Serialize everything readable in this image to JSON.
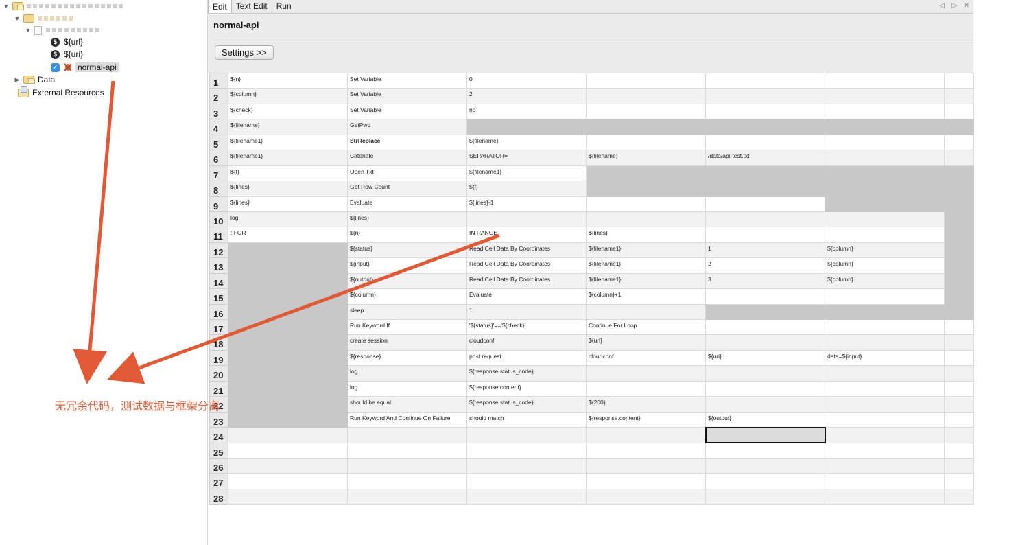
{
  "tree": {
    "nodes": [
      {
        "type": "project-root",
        "label": "",
        "blurred": true
      },
      {
        "type": "suite",
        "label": "",
        "blurred": true
      },
      {
        "type": "resource",
        "label": "",
        "blurred": true
      },
      {
        "type": "variable",
        "label": "${url}"
      },
      {
        "type": "variable",
        "label": "${uri}"
      },
      {
        "type": "testcase",
        "label": "normal-api",
        "checked": true,
        "selected": true
      },
      {
        "type": "folder",
        "label": "Data"
      },
      {
        "type": "external",
        "label": "External Resources"
      }
    ]
  },
  "tabs": [
    {
      "label": "Edit",
      "active": true
    },
    {
      "label": "Text Edit",
      "active": false
    },
    {
      "label": "Run",
      "active": false
    }
  ],
  "tab_nav": {
    "prev": "◁",
    "next": "▷",
    "close": "✕"
  },
  "test_name": "normal-api",
  "settings_button": "Settings >>",
  "grid": {
    "rows": [
      {
        "n": "1",
        "cells": [
          [
            "${n}",
            "v"
          ],
          [
            "Set Variable",
            "k"
          ],
          [
            "0",
            "b"
          ],
          [
            "",
            ""
          ],
          [
            "",
            ""
          ],
          [
            "",
            ""
          ],
          [
            "",
            ""
          ]
        ]
      },
      {
        "n": "2",
        "cells": [
          [
            "${column}",
            "v"
          ],
          [
            "Set Variable",
            "k"
          ],
          [
            "2",
            "b"
          ],
          [
            "",
            ""
          ],
          [
            "",
            ""
          ],
          [
            "",
            ""
          ],
          [
            "",
            ""
          ]
        ]
      },
      {
        "n": "3",
        "cells": [
          [
            "${check}",
            "v"
          ],
          [
            "Set Variable",
            "k"
          ],
          [
            "no",
            "b"
          ],
          [
            "",
            ""
          ],
          [
            "",
            ""
          ],
          [
            "",
            ""
          ],
          [
            "",
            ""
          ]
        ]
      },
      {
        "n": "4",
        "cells": [
          [
            "${filename}",
            "v"
          ],
          [
            "GetPwd",
            "k"
          ],
          [
            "",
            "g"
          ],
          [
            "",
            "g"
          ],
          [
            "",
            "g"
          ],
          [
            "",
            "g"
          ],
          [
            "",
            "g"
          ]
        ]
      },
      {
        "n": "5",
        "cells": [
          [
            "${filename1}",
            "v"
          ],
          [
            "StrReplace",
            "B"
          ],
          [
            "${filename}",
            "v"
          ],
          [
            "",
            ""
          ],
          [
            "",
            ""
          ],
          [
            "",
            ""
          ],
          [
            "",
            ""
          ]
        ]
      },
      {
        "n": "6",
        "cells": [
          [
            "${filename1}",
            "v"
          ],
          [
            "Catenate",
            "k"
          ],
          [
            "SEPARATOR=",
            "b"
          ],
          [
            "${filename}",
            "v"
          ],
          [
            "/data/api-test.txt",
            "b"
          ],
          [
            "",
            ""
          ],
          [
            "",
            ""
          ]
        ]
      },
      {
        "n": "7",
        "cells": [
          [
            "${f}",
            "v"
          ],
          [
            "Open Txt",
            "k"
          ],
          [
            "${filename1}",
            "v"
          ],
          [
            "",
            "g"
          ],
          [
            "",
            "g"
          ],
          [
            "",
            "g"
          ],
          [
            "",
            "g"
          ]
        ]
      },
      {
        "n": "8",
        "cells": [
          [
            "${lines}",
            "v"
          ],
          [
            "Get Row Count",
            "k"
          ],
          [
            "${f}",
            "v"
          ],
          [
            "",
            "g"
          ],
          [
            "",
            "g"
          ],
          [
            "",
            "g"
          ],
          [
            "",
            "g"
          ]
        ]
      },
      {
        "n": "9",
        "cells": [
          [
            "${lines}",
            "v"
          ],
          [
            "Evaluate",
            "k"
          ],
          [
            "${lines}-1",
            "b"
          ],
          [
            "",
            ""
          ],
          [
            "",
            ""
          ],
          [
            "",
            "g"
          ],
          [
            "",
            "g"
          ]
        ]
      },
      {
        "n": "10",
        "cells": [
          [
            "log",
            "k"
          ],
          [
            "${lines}",
            "v"
          ],
          [
            "",
            ""
          ],
          [
            "",
            ""
          ],
          [
            "",
            ""
          ],
          [
            "",
            ""
          ],
          [
            "",
            "g"
          ]
        ]
      },
      {
        "n": "11",
        "cells": [
          [
            ": FOR",
            "b"
          ],
          [
            "${n}",
            "v"
          ],
          [
            "IN RANGE",
            "b"
          ],
          [
            "${lines}",
            "v"
          ],
          [
            "",
            ""
          ],
          [
            "",
            ""
          ],
          [
            "",
            "g"
          ]
        ]
      },
      {
        "n": "12",
        "cells": [
          [
            "",
            "g"
          ],
          [
            "${status}",
            "v"
          ],
          [
            "Read Cell Data By Coordinates",
            "k"
          ],
          [
            "${filename1}",
            "v"
          ],
          [
            "1",
            "b"
          ],
          [
            "${column}",
            "v"
          ],
          [
            "",
            "g"
          ]
        ]
      },
      {
        "n": "13",
        "cells": [
          [
            "",
            "g"
          ],
          [
            "${input}",
            "v"
          ],
          [
            "Read Cell Data By Coordinates",
            "k"
          ],
          [
            "${filename1}",
            "v"
          ],
          [
            "2",
            "b"
          ],
          [
            "${column}",
            "v"
          ],
          [
            "",
            "g"
          ]
        ]
      },
      {
        "n": "14",
        "cells": [
          [
            "",
            "g"
          ],
          [
            "${output}",
            "v"
          ],
          [
            "Read Cell Data By Coordinates",
            "k"
          ],
          [
            "${filename1}",
            "v"
          ],
          [
            "3",
            "b"
          ],
          [
            "${column}",
            "v"
          ],
          [
            "",
            "g"
          ]
        ]
      },
      {
        "n": "15",
        "cells": [
          [
            "",
            "g"
          ],
          [
            "${column}",
            "v"
          ],
          [
            "Evaluate",
            "k"
          ],
          [
            "${column}+1",
            "b"
          ],
          [
            "",
            ""
          ],
          [
            "",
            ""
          ],
          [
            "",
            "g"
          ]
        ]
      },
      {
        "n": "16",
        "cells": [
          [
            "",
            "g"
          ],
          [
            "sleep",
            "k"
          ],
          [
            "1",
            "b"
          ],
          [
            "",
            ""
          ],
          [
            "",
            "g"
          ],
          [
            "",
            "g"
          ],
          [
            "",
            "g"
          ]
        ]
      },
      {
        "n": "17",
        "cells": [
          [
            "",
            "g"
          ],
          [
            "Run Keyword If",
            "k"
          ],
          [
            "'${status}'=='${check}'",
            "b"
          ],
          [
            "Continue For Loop",
            "k"
          ],
          [
            "",
            ""
          ],
          [
            "",
            ""
          ],
          [
            "",
            ""
          ]
        ]
      },
      {
        "n": "18",
        "cells": [
          [
            "",
            "g"
          ],
          [
            "create session",
            "k"
          ],
          [
            "cloudconf",
            "b"
          ],
          [
            "${url}",
            "v"
          ],
          [
            "",
            ""
          ],
          [
            "",
            ""
          ],
          [
            "",
            ""
          ]
        ]
      },
      {
        "n": "19",
        "cells": [
          [
            "",
            "g"
          ],
          [
            "${response}",
            "v"
          ],
          [
            "post request",
            "k"
          ],
          [
            "cloudconf",
            "b"
          ],
          [
            "${uri}",
            "v"
          ],
          [
            "data=${input}",
            "b"
          ],
          [
            "",
            ""
          ]
        ]
      },
      {
        "n": "20",
        "cells": [
          [
            "",
            "g"
          ],
          [
            "log",
            "k"
          ],
          [
            "${response.status_code}",
            "v"
          ],
          [
            "",
            ""
          ],
          [
            "",
            ""
          ],
          [
            "",
            ""
          ],
          [
            "",
            ""
          ]
        ]
      },
      {
        "n": "21",
        "cells": [
          [
            "",
            "g"
          ],
          [
            "log",
            "k"
          ],
          [
            "${response.content}",
            "v"
          ],
          [
            "",
            ""
          ],
          [
            "",
            ""
          ],
          [
            "",
            ""
          ],
          [
            "",
            ""
          ]
        ]
      },
      {
        "n": "22",
        "cells": [
          [
            "",
            "g"
          ],
          [
            "should be equal",
            "k"
          ],
          [
            "${response.status_code}",
            "v"
          ],
          [
            "${200}",
            "p"
          ],
          [
            "",
            ""
          ],
          [
            "",
            ""
          ],
          [
            "",
            ""
          ]
        ]
      },
      {
        "n": "23",
        "cells": [
          [
            "",
            "g"
          ],
          [
            "Run Keyword And Continue On Failure",
            "k"
          ],
          [
            "should match",
            "k"
          ],
          [
            "${response.content}",
            "v"
          ],
          [
            "${output}",
            "v"
          ],
          [
            "",
            ""
          ],
          [
            "",
            ""
          ]
        ]
      },
      {
        "n": "24",
        "cells": [
          [
            "",
            ""
          ],
          [
            "",
            ""
          ],
          [
            "",
            ""
          ],
          [
            "",
            ""
          ],
          [
            "",
            "sel"
          ],
          [
            "",
            ""
          ],
          [
            "",
            ""
          ]
        ]
      },
      {
        "n": "25",
        "cells": [
          [
            "",
            ""
          ],
          [
            "",
            ""
          ],
          [
            "",
            ""
          ],
          [
            "",
            ""
          ],
          [
            "",
            ""
          ],
          [
            "",
            ""
          ],
          [
            "",
            ""
          ]
        ]
      },
      {
        "n": "26",
        "cells": [
          [
            "",
            ""
          ],
          [
            "",
            ""
          ],
          [
            "",
            ""
          ],
          [
            "",
            ""
          ],
          [
            "",
            ""
          ],
          [
            "",
            ""
          ],
          [
            "",
            ""
          ]
        ]
      },
      {
        "n": "27",
        "cells": [
          [
            "",
            ""
          ],
          [
            "",
            ""
          ],
          [
            "",
            ""
          ],
          [
            "",
            ""
          ],
          [
            "",
            ""
          ],
          [
            "",
            ""
          ],
          [
            "",
            ""
          ]
        ]
      },
      {
        "n": "28",
        "cells": [
          [
            "",
            ""
          ],
          [
            "",
            ""
          ],
          [
            "",
            ""
          ],
          [
            "",
            ""
          ],
          [
            "",
            ""
          ],
          [
            "",
            ""
          ],
          [
            "",
            ""
          ]
        ]
      }
    ]
  },
  "annotation": {
    "text": "无冗余代码，测试数据与框架分离",
    "color": "#e15a35"
  },
  "colors": {
    "variable": "#3d8a2c",
    "keyword": "#3d6fb8",
    "number_var": "#a234c9",
    "grid_gray": "#c8c8c8"
  }
}
